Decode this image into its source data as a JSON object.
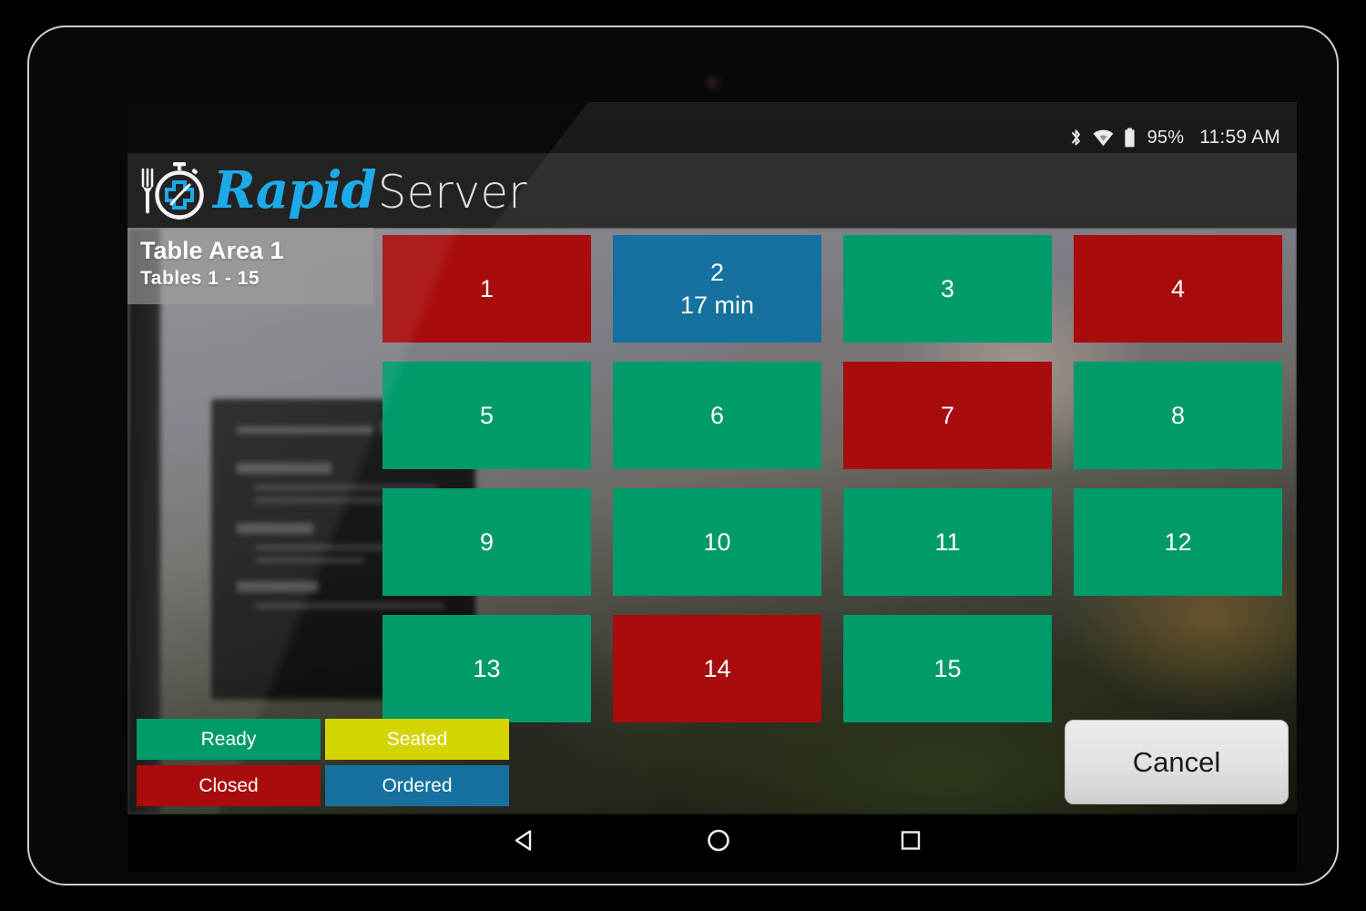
{
  "device": {
    "camera_icon": "front-camera-dot"
  },
  "status_bar": {
    "bluetooth_icon": "bluetooth-icon",
    "wifi_icon": "wifi-icon",
    "battery_icon": "battery-icon",
    "battery_percent": "95%",
    "clock": "11:59 AM"
  },
  "header": {
    "logo_icon": "fork-stopwatch-logo-icon",
    "brand_first": "Rapid",
    "brand_second": "Server"
  },
  "area": {
    "title": "Table Area 1",
    "subtitle": "Tables 1 - 15"
  },
  "tables": [
    {
      "number": "1",
      "status": "closed",
      "status_label": "Closed",
      "detail": ""
    },
    {
      "number": "2",
      "status": "ordered",
      "status_label": "Ordered",
      "detail": "17 min"
    },
    {
      "number": "3",
      "status": "ready",
      "status_label": "Ready",
      "detail": ""
    },
    {
      "number": "4",
      "status": "closed",
      "status_label": "Closed",
      "detail": ""
    },
    {
      "number": "5",
      "status": "ready",
      "status_label": "Ready",
      "detail": ""
    },
    {
      "number": "6",
      "status": "ready",
      "status_label": "Ready",
      "detail": ""
    },
    {
      "number": "7",
      "status": "closed",
      "status_label": "Closed",
      "detail": ""
    },
    {
      "number": "8",
      "status": "ready",
      "status_label": "Ready",
      "detail": ""
    },
    {
      "number": "9",
      "status": "ready",
      "status_label": "Ready",
      "detail": ""
    },
    {
      "number": "10",
      "status": "ready",
      "status_label": "Ready",
      "detail": ""
    },
    {
      "number": "11",
      "status": "ready",
      "status_label": "Ready",
      "detail": ""
    },
    {
      "number": "12",
      "status": "ready",
      "status_label": "Ready",
      "detail": ""
    },
    {
      "number": "13",
      "status": "ready",
      "status_label": "Ready",
      "detail": ""
    },
    {
      "number": "14",
      "status": "closed",
      "status_label": "Closed",
      "detail": ""
    },
    {
      "number": "15",
      "status": "ready",
      "status_label": "Ready",
      "detail": ""
    }
  ],
  "legend": [
    {
      "label": "Ready",
      "status": "ready",
      "color": "#009a6b"
    },
    {
      "label": "Seated",
      "status": "seated",
      "color": "#d4d400"
    },
    {
      "label": "Closed",
      "status": "closed",
      "color": "#a80c0c"
    },
    {
      "label": "Ordered",
      "status": "ordered",
      "color": "#15719e"
    }
  ],
  "actions": {
    "cancel_label": "Cancel"
  },
  "nav_bar": {
    "back_icon": "back-triangle-icon",
    "home_icon": "home-circle-icon",
    "recents_icon": "recents-square-icon"
  },
  "colors": {
    "ready": "#009a6b",
    "seated": "#d4d400",
    "closed": "#a80c0c",
    "ordered": "#15719e",
    "brand_blue": "#1cabe8",
    "header_bar": "#232323"
  }
}
